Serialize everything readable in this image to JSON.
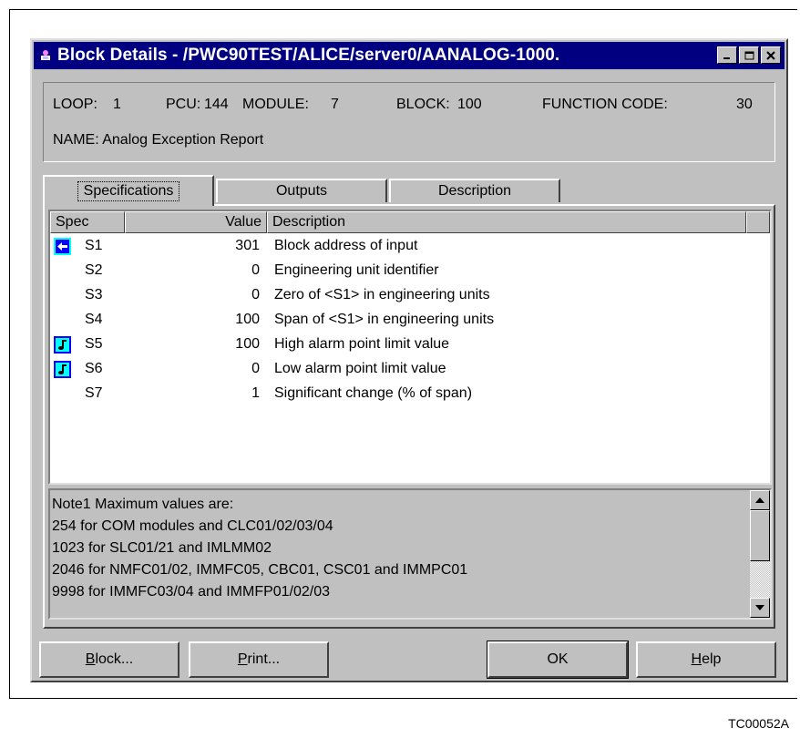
{
  "window": {
    "title": "Block Details - /PWC90TEST/ALICE/server0/AANALOG-1000.",
    "title_icon": "block-details-app-icon",
    "controls": {
      "minimize": "minimize-icon",
      "maximize": "maximize-icon",
      "close": "close-icon"
    }
  },
  "info": {
    "loop_label": "LOOP:",
    "loop_value": "1",
    "pcu_label": "PCU:",
    "pcu_value": "144",
    "module_label": "MODULE:",
    "module_value": "7",
    "block_label": "BLOCK:",
    "block_value": "100",
    "fc_label": "FUNCTION CODE:",
    "fc_value": "30",
    "name_label": "NAME:",
    "name_value": "Analog Exception Report"
  },
  "tabs": [
    {
      "label": "Specifications",
      "active": true
    },
    {
      "label": "Outputs",
      "active": false
    },
    {
      "label": "Description",
      "active": false
    }
  ],
  "list": {
    "columns": [
      "Spec",
      "Value",
      "Description"
    ],
    "rows": [
      {
        "icon": "input-link-icon",
        "spec": "S1",
        "value": "301",
        "description": "Block address of input"
      },
      {
        "icon": "",
        "spec": "S2",
        "value": "0",
        "description": "Engineering unit identifier"
      },
      {
        "icon": "",
        "spec": "S3",
        "value": "0",
        "description": "Zero of <S1> in engineering units"
      },
      {
        "icon": "",
        "spec": "S4",
        "value": "100",
        "description": "Span of <S1> in engineering units"
      },
      {
        "icon": "tunable-note-icon",
        "spec": "S5",
        "value": "100",
        "description": "High alarm point limit value"
      },
      {
        "icon": "tunable-note-icon",
        "spec": "S6",
        "value": "0",
        "description": "Low alarm point limit value"
      },
      {
        "icon": "",
        "spec": "S7",
        "value": "1",
        "description": "Significant change (% of span)"
      }
    ]
  },
  "notes": {
    "lines": [
      "Note1  Maximum values are:",
      "254 for COM modules and CLC01/02/03/04",
      "1023 for SLC01/21 and IMLMM02",
      "2046 for NMFC01/02, IMMFC05, CBC01, CSC01 and IMMPC01",
      "9998 for IMMFC03/04 and IMMFP01/02/03"
    ]
  },
  "buttons": {
    "block": {
      "accel": "B",
      "rest": "lock..."
    },
    "print": {
      "accel": "P",
      "rest": "rint..."
    },
    "ok": {
      "label": "OK"
    },
    "help": {
      "accel": "H",
      "rest": "elp"
    }
  },
  "figure_id": "TC00052A",
  "colors": {
    "titlebar": "#000080",
    "face": "#c0c0c0",
    "icon_blue": "#0000ff",
    "icon_cyan": "#00ffff"
  }
}
